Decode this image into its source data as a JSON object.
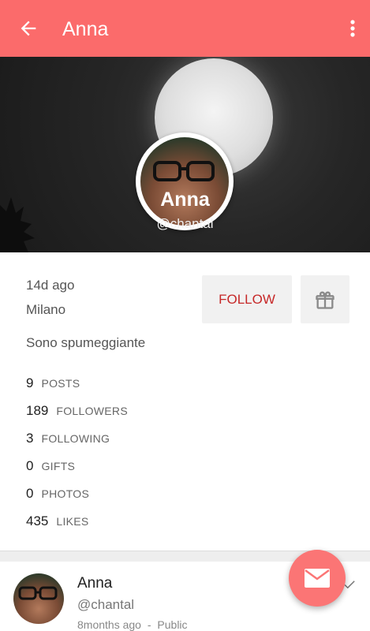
{
  "appbar": {
    "title": "Anna",
    "back_icon": "arrow-back-icon",
    "more_icon": "more-vert-icon",
    "color": "#fb6b6b"
  },
  "profile": {
    "name": "Anna",
    "handle": "@chantal"
  },
  "info": {
    "last_seen": "14d ago",
    "location": "Milano",
    "bio": "Sono spumeggiante"
  },
  "actions": {
    "follow_label": "FOLLOW",
    "gift_icon": "gift-icon"
  },
  "stats": [
    {
      "num": "9",
      "label": "POSTS"
    },
    {
      "num": "189",
      "label": "FOLLOWERS"
    },
    {
      "num": "3",
      "label": "FOLLOWING"
    },
    {
      "num": "0",
      "label": "GIFTS"
    },
    {
      "num": "0",
      "label": "PHOTOS"
    },
    {
      "num": "435",
      "label": "LIKES"
    }
  ],
  "post": {
    "name": "Anna",
    "handle": "@chantal",
    "time": "8months ago",
    "separator": "-",
    "visibility": "Public"
  },
  "fab": {
    "icon": "mail-icon",
    "color": "#fb7575"
  }
}
